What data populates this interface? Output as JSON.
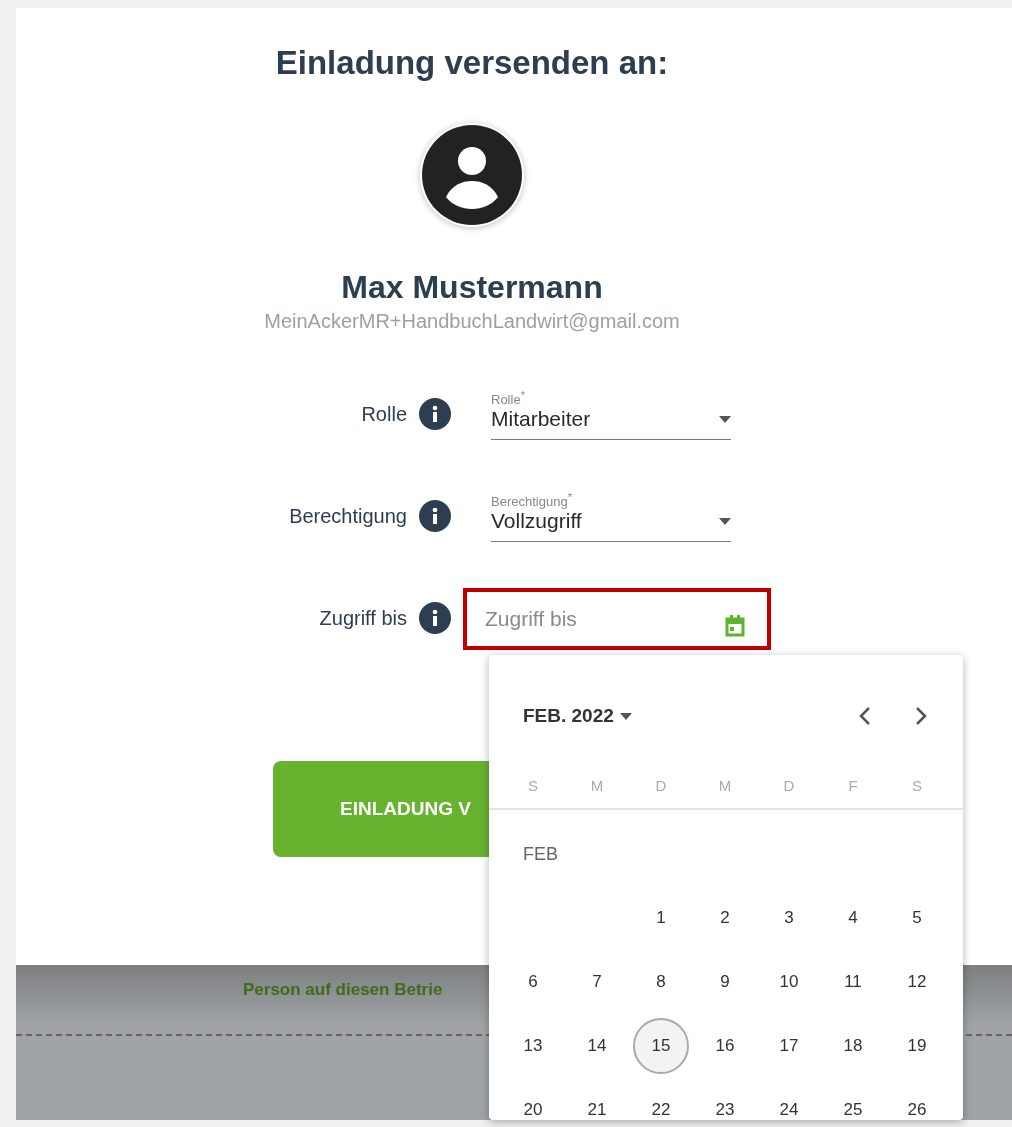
{
  "dialog": {
    "title": "Einladung versenden an:",
    "person": {
      "name": "Max Mustermann",
      "email": "MeinAckerMR+HandbuchLandwirt@gmail.com"
    },
    "fields": [
      {
        "kind": "select",
        "label": "Rolle",
        "floating_label": "Rolle$^{*}$",
        "value": "Mitarbeiter"
      },
      {
        "kind": "select",
        "label": "Berechtigung",
        "floating_label": "Berechtigung$^{*}$",
        "value": "Vollzugriff"
      },
      {
        "kind": "date",
        "label": "Zugriff bis",
        "placeholder": "Zugriff bis",
        "highlighted": true
      }
    ],
    "submit_button": "EINLADUNG V"
  },
  "footer": {
    "text": "Person auf diesen Betrie"
  },
  "calendar": {
    "month_year": "FEB. 2022",
    "weekdays": [
      "S",
      "M",
      "D",
      "M",
      "D",
      "F",
      "S"
    ],
    "month_label": "FEB",
    "weeks": [
      {
        "days": [
          {
            "label": "1",
            "selected": false
          },
          {
            "label": "2",
            "selected": false
          },
          {
            "label": "3",
            "selected": false
          },
          {
            "label": "4",
            "selected": false
          },
          {
            "label": "5",
            "selected": false
          }
        ]
      },
      {
        "days": [
          {
            "label": "6",
            "selected": false
          },
          {
            "label": "7",
            "selected": false
          },
          {
            "label": "8",
            "selected": false
          },
          {
            "label": "9",
            "selected": false
          },
          {
            "label": "10",
            "selected": false
          },
          {
            "label": "11",
            "selected": false
          },
          {
            "label": "12",
            "selected": false
          }
        ]
      },
      {
        "days": [
          {
            "label": "13",
            "selected": false
          },
          {
            "label": "14",
            "selected": false
          },
          {
            "label": "15",
            "selected": true
          },
          {
            "label": "16",
            "selected": false
          },
          {
            "label": "17",
            "selected": false
          },
          {
            "label": "18",
            "selected": false
          },
          {
            "label": "19",
            "selected": false
          }
        ]
      },
      {
        "days": [
          {
            "label": "20",
            "selected": false
          },
          {
            "label": "21",
            "selected": false
          },
          {
            "label": "22",
            "selected": false
          },
          {
            "label": "23",
            "selected": false
          },
          {
            "label": "24",
            "selected": false
          },
          {
            "label": "25",
            "selected": false
          },
          {
            "label": "26",
            "selected": false
          }
        ]
      }
    ]
  }
}
